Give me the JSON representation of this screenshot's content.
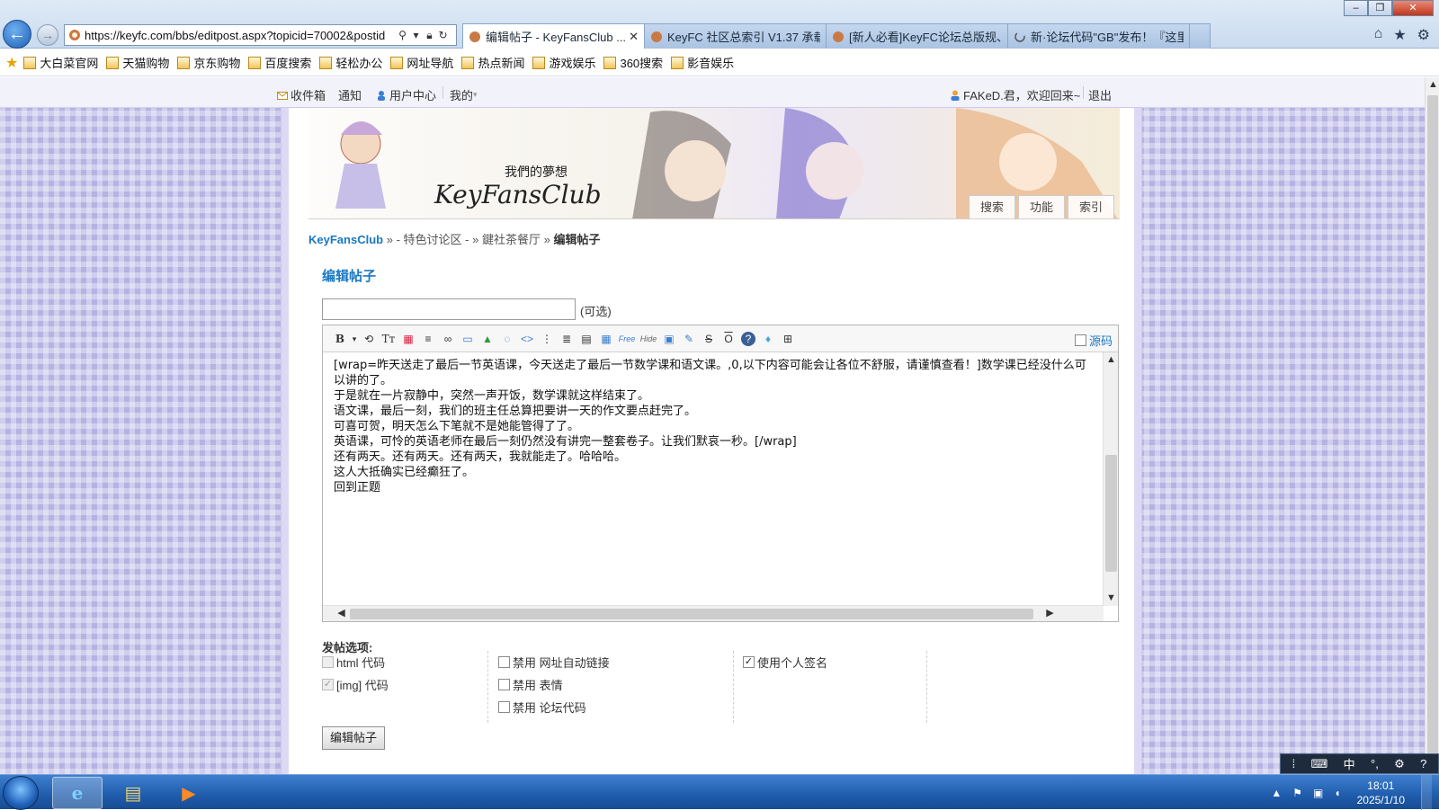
{
  "browser": {
    "address": "https://keyfc.com/bbs/editpost.aspx?topicid=70002&postid",
    "tabs": [
      {
        "label": "编辑帖子 - KeyFansClub ...",
        "active": true
      },
      {
        "label": "KeyFC 社区总索引 V1.37 承载..."
      },
      {
        "label": "[新人必看]KeyFC论坛总版规、..."
      },
      {
        "label": "新·论坛代码\"GB\"发布！『这里..."
      }
    ],
    "favorites": [
      "大白菜官网",
      "天猫购物",
      "京东购物",
      "百度搜索",
      "轻松办公",
      "网址导航",
      "热点新闻",
      "游戏娱乐",
      "360搜索",
      "影音娱乐"
    ]
  },
  "topnav": {
    "inbox": "收件箱",
    "notify": "通知",
    "user_center": "用户中心",
    "mine": "我的",
    "welcome": "FAKeD.君，欢迎回来~",
    "logout": "退出"
  },
  "banner": {
    "tagline": "我們的夢想",
    "logo": "KeyFansClub",
    "menu": [
      "搜索",
      "功能",
      "索引"
    ]
  },
  "breadcrumb": {
    "home": "KeyFansClub",
    "l1": "- 特色讨论区 -",
    "l2": "鍵社茶餐厅",
    "current": "编辑帖子",
    "sep": "»"
  },
  "form": {
    "title": "编辑帖子",
    "subject_value": "",
    "optional": "(可选)",
    "source_label": "源码",
    "toolbar": [
      "B",
      "▾",
      "⟲",
      "Tт",
      "▦",
      "≡",
      "∞",
      "▭",
      "▲",
      "◌",
      "<>",
      "⋮",
      "≣",
      "▤",
      "▦",
      "Free",
      "Hide",
      "▣",
      "✎",
      "S",
      "O",
      "?",
      "♦",
      "⊞"
    ],
    "body": [
      "",
      "[wrap=昨天送走了最后一节英语课，今天送走了最后一节数学课和语文课。,0,以下内容可能会让各位不舒服，请谨慎查看！]数学课已经没什么可以讲的了。",
      "于是就在一片寂静中，突然一声开饭，数学课就这样结束了。",
      "语文课，最后一刻，我们的班主任总算把要讲一天的作文要点赶完了。",
      "可喜可贺，明天怎么下笔就不是她能管得了了。",
      "英语课，可怜的英语老师在最后一刻仍然没有讲完一整套卷子。让我们默哀一秒。[/wrap]",
      "",
      "",
      "还有两天。还有两天。还有两天，我就能走了。哈哈哈。",
      "",
      "",
      "这人大抵确实已经癫狂了。",
      "",
      "回到正题"
    ],
    "options_title": "发帖选项:",
    "options": {
      "html": "html 代码",
      "img": "[img] 代码",
      "no_autolink": "禁用 网址自动链接",
      "no_smilies": "禁用 表情",
      "no_bbcode": "禁用 论坛代码",
      "signature": "使用个人签名"
    },
    "submit": "编辑帖子"
  },
  "taskbar": {
    "time": "18:01",
    "date": "2025/1/10",
    "ime": "中"
  }
}
